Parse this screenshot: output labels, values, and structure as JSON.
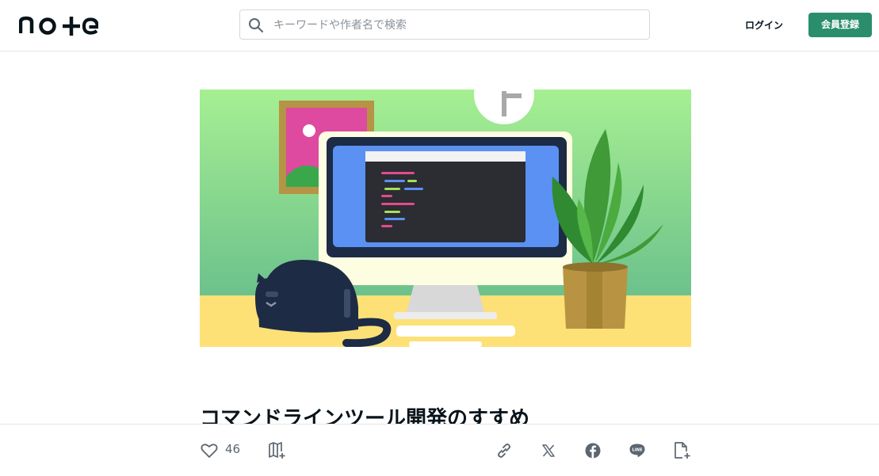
{
  "header": {
    "logo_text": "note",
    "search": {
      "placeholder": "キーワードや作者名で検索",
      "value": ""
    },
    "login_label": "ログイン",
    "signup_label": "会員登録",
    "brand_color": "#2a8e6c"
  },
  "hero": {
    "image_alt": "desk with computer, cat and plant illustration"
  },
  "article": {
    "title": "コマンドラインツール開発のすすめ"
  },
  "action_bar": {
    "like_count": "46",
    "icons": [
      "heart-icon",
      "magazine-add-icon",
      "link-icon",
      "x-icon",
      "facebook-icon",
      "line-icon",
      "document-add-icon"
    ]
  }
}
